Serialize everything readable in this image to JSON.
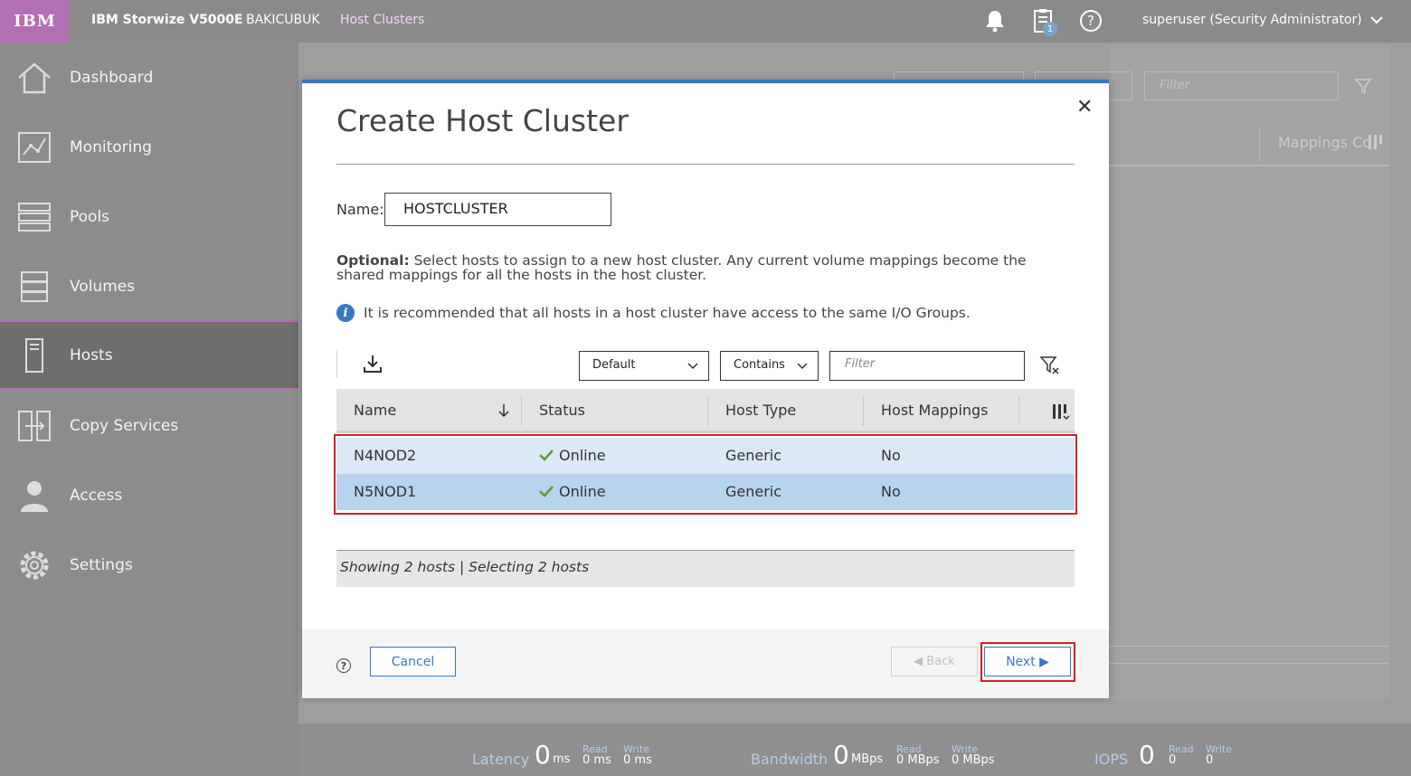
{
  "topbar": {
    "logo": "IBM",
    "product": "IBM Storwize V5000E",
    "system": "BAKICUBUK",
    "page": "Host Clusters",
    "notification_count": "1",
    "user": "superuser (Security Administrator)"
  },
  "sidebar": {
    "items": [
      {
        "label": "Dashboard",
        "icon": "home-icon"
      },
      {
        "label": "Monitoring",
        "icon": "monitoring-icon"
      },
      {
        "label": "Pools",
        "icon": "pools-icon"
      },
      {
        "label": "Volumes",
        "icon": "volumes-icon"
      },
      {
        "label": "Hosts",
        "icon": "hosts-icon",
        "active": true
      },
      {
        "label": "Copy Services",
        "icon": "copy-services-icon"
      },
      {
        "label": "Access",
        "icon": "access-icon"
      },
      {
        "label": "Settings",
        "icon": "settings-icon"
      }
    ]
  },
  "background": {
    "filter_placeholder": "Filter",
    "mappings_header": "Mappings Cc"
  },
  "stats": {
    "latency": {
      "label": "Latency",
      "value": "0",
      "unit": "ms",
      "read_label": "Read",
      "read_value": "0 ms",
      "write_label": "Write",
      "write_value": "0 ms"
    },
    "bandwidth": {
      "label": "Bandwidth",
      "value": "0",
      "unit": "MBps",
      "read_label": "Read",
      "read_value": "0 MBps",
      "write_label": "Write",
      "write_value": "0 MBps"
    },
    "iops": {
      "label": "IOPS",
      "value": "0",
      "read_label": "Read",
      "read_value": "0",
      "write_label": "Write",
      "write_value": "0"
    }
  },
  "modal": {
    "title": "Create Host Cluster",
    "name_label": "Name:",
    "name_value": "HOSTCLUSTER",
    "optional_bold": "Optional:",
    "optional_text": " Select hosts to assign to a new host cluster. Any current volume mappings become the shared mappings for all the hosts in the host cluster.",
    "info_text": "It is recommended that all hosts in a host cluster have access to the same I/O Groups.",
    "toolbar": {
      "view_select": "Default",
      "match_select": "Contains",
      "filter_placeholder": "Filter"
    },
    "table": {
      "columns": [
        "Name",
        "Status",
        "Host Type",
        "Host Mappings"
      ],
      "rows": [
        {
          "name": "N4NOD2",
          "status": "Online",
          "host_type": "Generic",
          "host_mappings": "No"
        },
        {
          "name": "N5NOD1",
          "status": "Online",
          "host_type": "Generic",
          "host_mappings": "No"
        }
      ],
      "summary": "Showing 2 hosts | Selecting 2 hosts"
    },
    "footer": {
      "cancel": "Cancel",
      "back": "◀ Back",
      "next": "Next ▶"
    }
  },
  "colors": {
    "accent": "#3a78be",
    "brand": "#b36fb3",
    "highlight": "#d0202a"
  }
}
